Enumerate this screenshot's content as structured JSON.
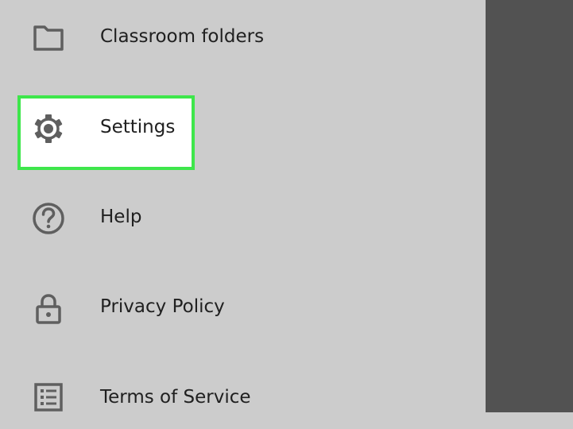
{
  "drawer": {
    "items": [
      {
        "label": "Classroom folders",
        "icon": "folder-icon"
      },
      {
        "label": "Settings",
        "icon": "gear-icon",
        "highlighted": true
      },
      {
        "label": "Help",
        "icon": "help-circle-icon"
      },
      {
        "label": "Privacy Policy",
        "icon": "lock-icon"
      },
      {
        "label": "Terms of Service",
        "icon": "document-list-icon"
      }
    ]
  },
  "colors": {
    "drawer_bg": "#cccccc",
    "scrim": "#525252",
    "highlight_border": "#3ee64b",
    "highlight_fill": "#ffffff",
    "icon": "#5f5f5f",
    "text": "#202020"
  }
}
